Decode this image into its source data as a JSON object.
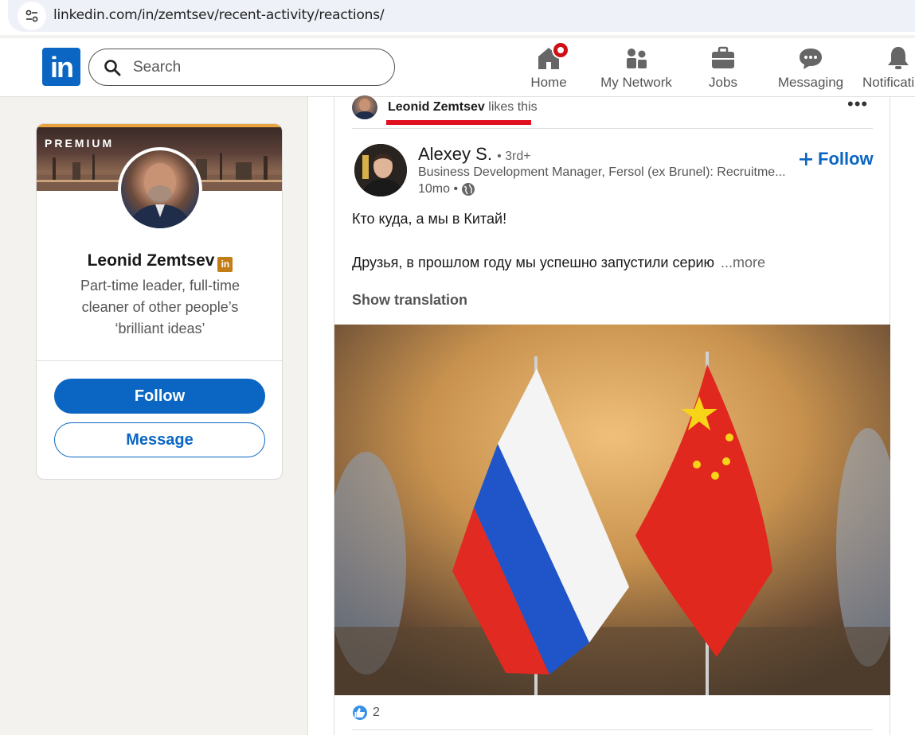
{
  "browser": {
    "url": "linkedin.com/in/zemtsev/recent-activity/reactions/"
  },
  "nav": {
    "logo_text": "in",
    "search_placeholder": "Search",
    "items": [
      {
        "label": "Home",
        "icon": "home-icon"
      },
      {
        "label": "My Network",
        "icon": "network-icon"
      },
      {
        "label": "Jobs",
        "icon": "briefcase-icon"
      },
      {
        "label": "Messaging",
        "icon": "messaging-icon"
      },
      {
        "label": "Notificati",
        "icon": "bell-icon"
      }
    ]
  },
  "profile": {
    "premium_label": "PREMIUM",
    "name": "Leonid Zemtsev",
    "badge": "in",
    "headline": "Part-time leader, full-time cleaner of other people’s ‘brilliant ideas’",
    "follow_label": "Follow",
    "message_label": "Message"
  },
  "activity": {
    "actor_name": "Leonid Zemtsev",
    "action_text": "likes this",
    "more_label": "•••"
  },
  "post": {
    "author_name": "Alexey S.",
    "author_degree": "• 3rd+",
    "author_title": "Business Development Manager, Fersol (ex Brunel): Recruitme...",
    "time": "10mo •",
    "follow_label": "Follow",
    "text_line1": "Кто куда, а мы в Китай!",
    "text_line2": "Друзья, в прошлом году мы успешно запустили серию",
    "more_label": "...more",
    "show_translation": "Show translation",
    "reaction_count": "2"
  },
  "colors": {
    "brand": "#0a66c2",
    "premium": "#e7a33e",
    "notification": "#cc1016",
    "highlight_underline": "#e01020"
  }
}
